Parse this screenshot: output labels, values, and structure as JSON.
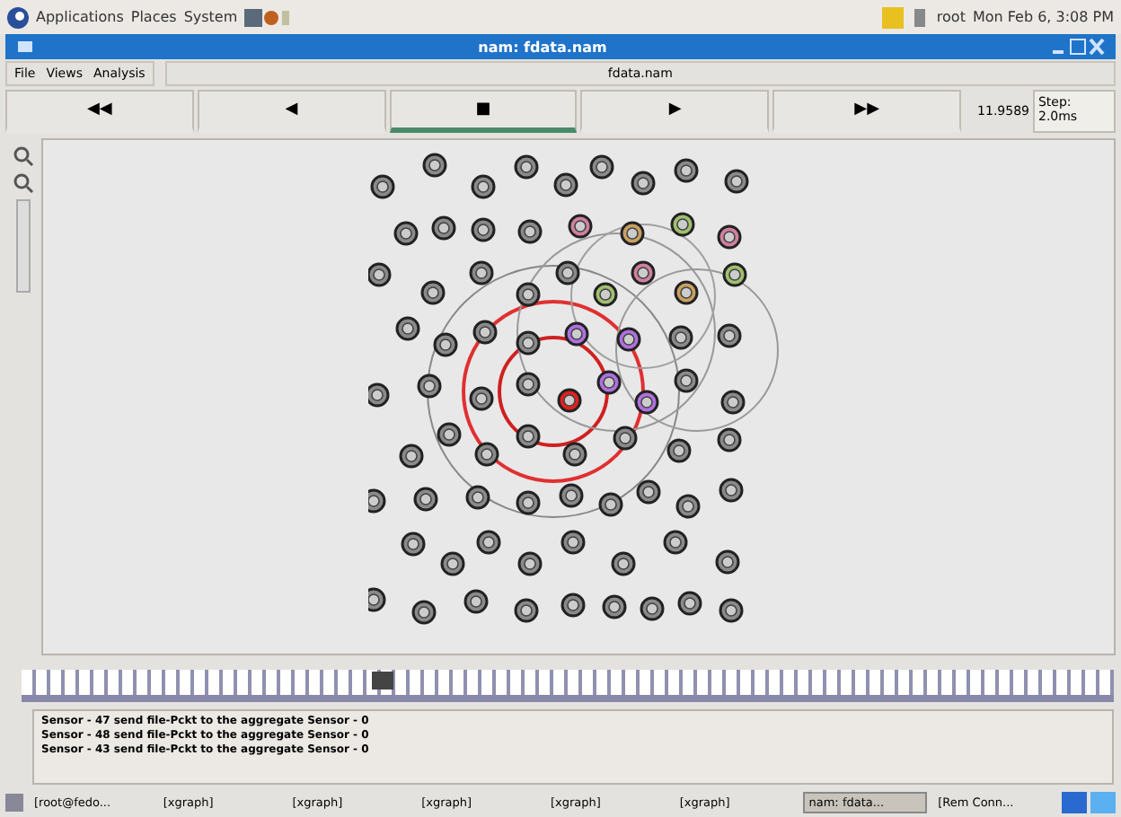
{
  "top_panel": {
    "menus": [
      "Applications",
      "Places",
      "System"
    ],
    "user": "root",
    "clock": "Mon Feb 6, 3:08 PM"
  },
  "window": {
    "title": "nam: fdata.nam"
  },
  "menu": [
    "File",
    "Views",
    "Analysis"
  ],
  "file_label": "fdata.nam",
  "playback": [
    {
      "symbol": "◀◀",
      "selected": false
    },
    {
      "symbol": "◀",
      "selected": false
    },
    {
      "symbol": "■",
      "selected": true
    },
    {
      "symbol": "▶",
      "selected": false
    },
    {
      "symbol": "▶▶",
      "selected": false
    }
  ],
  "time": "11.9589",
  "step": "Step: 2.0ms",
  "timeline": {
    "level": 0.33
  },
  "log": [
    "Sensor - 47 send file-Pckt to the aggregate Sensor - 0",
    "Sensor - 48 send file-Pckt to the aggregate Sensor - 0",
    "Sensor - 43 send file-Pckt to the aggregate Sensor - 0"
  ],
  "taskbar": [
    {
      "label": "[root@fedo...",
      "selected": false
    },
    {
      "label": "[xgraph]",
      "selected": false
    },
    {
      "label": "[xgraph]",
      "selected": false
    },
    {
      "label": "[xgraph]",
      "selected": false
    },
    {
      "label": "[xgraph]",
      "selected": false
    },
    {
      "label": "[xgraph]",
      "selected": false
    },
    {
      "label": "nam: fdata...",
      "selected": true
    },
    {
      "label": "[Rem Conn...",
      "selected": false
    }
  ]
}
